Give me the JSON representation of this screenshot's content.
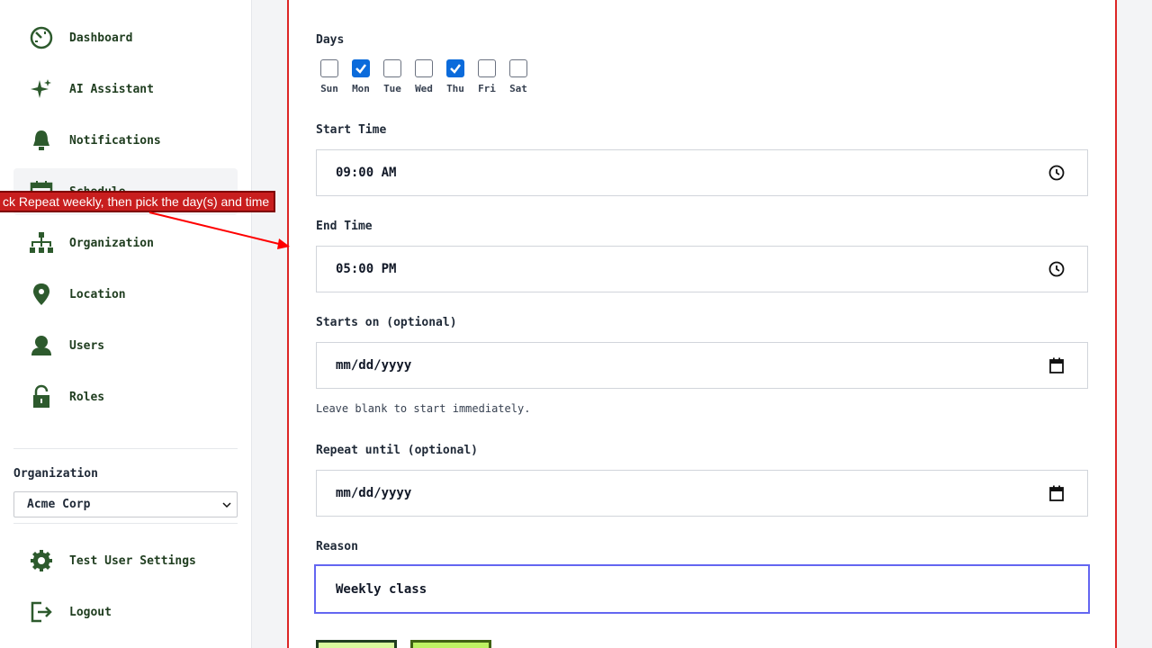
{
  "sidebar": {
    "items": [
      {
        "label": "Dashboard",
        "icon": "dashboard-icon"
      },
      {
        "label": "AI Assistant",
        "icon": "sparkle-icon"
      },
      {
        "label": "Notifications",
        "icon": "bell-icon"
      },
      {
        "label": "Schedule",
        "icon": "calendar-icon"
      },
      {
        "label": "Organization",
        "icon": "org-chart-icon"
      },
      {
        "label": "Location",
        "icon": "location-pin-icon"
      },
      {
        "label": "Users",
        "icon": "user-icon"
      },
      {
        "label": "Roles",
        "icon": "lock-icon"
      }
    ],
    "active_item": "Schedule",
    "organization_label": "Organization",
    "organization_selected": "Acme Corp",
    "settings_label": "Test User Settings",
    "logout_label": "Logout"
  },
  "form": {
    "days_label": "Days",
    "days": [
      {
        "label": "Sun",
        "checked": false
      },
      {
        "label": "Mon",
        "checked": true
      },
      {
        "label": "Tue",
        "checked": false
      },
      {
        "label": "Wed",
        "checked": false
      },
      {
        "label": "Thu",
        "checked": true
      },
      {
        "label": "Fri",
        "checked": false
      },
      {
        "label": "Sat",
        "checked": false
      }
    ],
    "start_time_label": "Start Time",
    "start_time_value": "09:00 AM",
    "end_time_label": "End Time",
    "end_time_value": "05:00 PM",
    "starts_on_label": "Starts on (optional)",
    "starts_on_placeholder": "mm/dd/yyyy",
    "starts_on_hint": "Leave blank to start immediately.",
    "repeat_until_label": "Repeat until (optional)",
    "repeat_until_placeholder": "mm/dd/yyyy",
    "reason_label": "Reason",
    "reason_value": "Weekly class"
  },
  "annotation": {
    "text": "ck Repeat weekly, then pick the day(s) and time"
  },
  "colors": {
    "accent_green": "#1f3d1f",
    "annotation_red": "#c81e1e",
    "checkbox_blue": "#0b6bdb",
    "focus_indigo": "#6366f1"
  }
}
